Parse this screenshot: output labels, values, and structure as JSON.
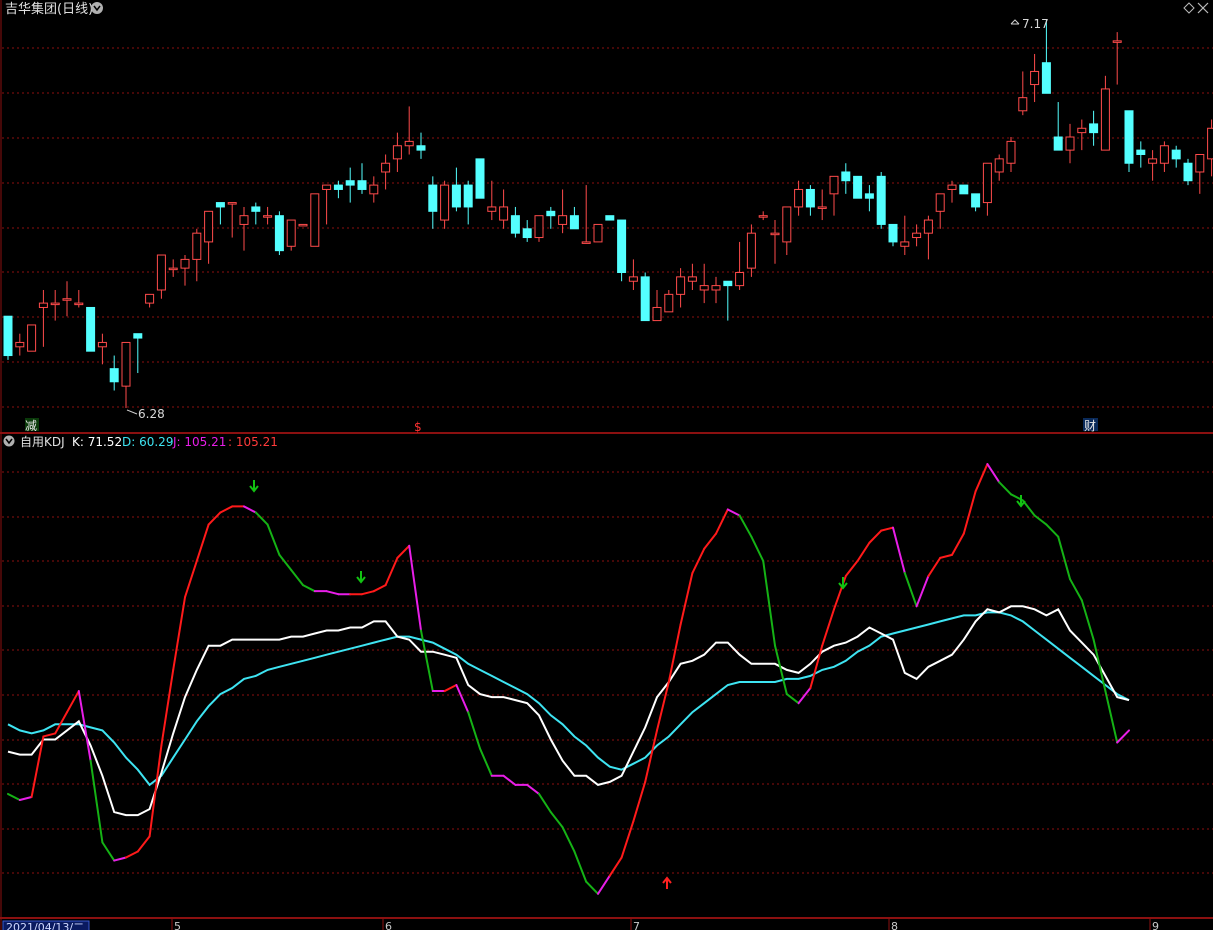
{
  "header": {
    "title": "吉华集团(日线)",
    "high_label": "7.17",
    "low_label": "6.28"
  },
  "markers": {
    "jian": "减",
    "s": "$",
    "cai": "财"
  },
  "indicator": {
    "name": "自用KDJ",
    "k_label": "K: 71.52",
    "d_label": "D: 60.29",
    "j_label": "J: 105.21",
    "extra_label": ": 105.21"
  },
  "date_axis": {
    "current_date": "2021/04/13/二",
    "month_ticks": [
      "5",
      "6",
      "7",
      "8",
      "9"
    ]
  },
  "colors": {
    "background": "#000000",
    "up": "#ff4b4b",
    "down": "#54ffff",
    "grid": "#8b1010",
    "k_line": "#ffffff",
    "d_line": "#3ee4f2",
    "j_up": "#ff1a1a",
    "j_down": "#15b215",
    "j_turn": "#e81ee8",
    "arrow_down": "#12c212",
    "arrow_up": "#ff2020"
  },
  "chart_data": [
    {
      "type": "candlestick",
      "title": "吉华集团(日线)",
      "price_annotations": [
        {
          "label": "7.17",
          "price": 7.17
        },
        {
          "label": "6.28",
          "price": 6.28
        }
      ],
      "candles": [
        {
          "o": 6.49,
          "h": 6.49,
          "l": 6.39,
          "c": 6.4
        },
        {
          "o": 6.42,
          "h": 6.45,
          "l": 6.4,
          "c": 6.43
        },
        {
          "o": 6.41,
          "h": 6.47,
          "l": 6.41,
          "c": 6.47
        },
        {
          "o": 6.51,
          "h": 6.55,
          "l": 6.42,
          "c": 6.52
        },
        {
          "o": 6.52,
          "h": 6.55,
          "l": 6.48,
          "c": 6.52
        },
        {
          "o": 6.53,
          "h": 6.57,
          "l": 6.49,
          "c": 6.53
        },
        {
          "o": 6.52,
          "h": 6.55,
          "l": 6.51,
          "c": 6.52
        },
        {
          "o": 6.51,
          "h": 6.51,
          "l": 6.41,
          "c": 6.41
        },
        {
          "o": 6.42,
          "h": 6.45,
          "l": 6.38,
          "c": 6.43
        },
        {
          "o": 6.37,
          "h": 6.4,
          "l": 6.32,
          "c": 6.34
        },
        {
          "o": 6.33,
          "h": 6.42,
          "l": 6.28,
          "c": 6.43
        },
        {
          "o": 6.45,
          "h": 6.45,
          "l": 6.36,
          "c": 6.44
        },
        {
          "o": 6.52,
          "h": 6.53,
          "l": 6.51,
          "c": 6.54
        },
        {
          "o": 6.55,
          "h": 6.56,
          "l": 6.53,
          "c": 6.63
        },
        {
          "o": 6.6,
          "h": 6.62,
          "l": 6.58,
          "c": 6.6
        },
        {
          "o": 6.6,
          "h": 6.63,
          "l": 6.56,
          "c": 6.62
        },
        {
          "o": 6.62,
          "h": 6.69,
          "l": 6.57,
          "c": 6.68
        },
        {
          "o": 6.66,
          "h": 6.68,
          "l": 6.61,
          "c": 6.73
        },
        {
          "o": 6.75,
          "h": 6.75,
          "l": 6.7,
          "c": 6.74
        },
        {
          "o": 6.75,
          "h": 6.75,
          "l": 6.67,
          "c": 6.75
        },
        {
          "o": 6.7,
          "h": 6.74,
          "l": 6.64,
          "c": 6.72
        },
        {
          "o": 6.74,
          "h": 6.75,
          "l": 6.7,
          "c": 6.73
        },
        {
          "o": 6.72,
          "h": 6.74,
          "l": 6.7,
          "c": 6.72
        },
        {
          "o": 6.72,
          "h": 6.73,
          "l": 6.63,
          "c": 6.64
        },
        {
          "o": 6.65,
          "h": 6.69,
          "l": 6.64,
          "c": 6.71
        },
        {
          "o": 6.7,
          "h": 6.7,
          "l": 6.7,
          "c": 6.7
        },
        {
          "o": 6.65,
          "h": 6.72,
          "l": 6.66,
          "c": 6.77
        },
        {
          "o": 6.78,
          "h": 6.79,
          "l": 6.7,
          "c": 6.79
        },
        {
          "o": 6.79,
          "h": 6.8,
          "l": 6.76,
          "c": 6.78
        },
        {
          "o": 6.8,
          "h": 6.83,
          "l": 6.75,
          "c": 6.79
        },
        {
          "o": 6.8,
          "h": 6.84,
          "l": 6.77,
          "c": 6.78
        },
        {
          "o": 6.77,
          "h": 6.81,
          "l": 6.75,
          "c": 6.79
        },
        {
          "o": 6.82,
          "h": 6.86,
          "l": 6.78,
          "c": 6.84
        },
        {
          "o": 6.85,
          "h": 6.91,
          "l": 6.82,
          "c": 6.88
        },
        {
          "o": 6.88,
          "h": 6.97,
          "l": 6.86,
          "c": 6.89
        },
        {
          "o": 6.88,
          "h": 6.91,
          "l": 6.85,
          "c": 6.87
        },
        {
          "o": 6.79,
          "h": 6.81,
          "l": 6.69,
          "c": 6.73
        },
        {
          "o": 6.71,
          "h": 6.8,
          "l": 6.69,
          "c": 6.79
        },
        {
          "o": 6.79,
          "h": 6.83,
          "l": 6.73,
          "c": 6.74
        },
        {
          "o": 6.79,
          "h": 6.8,
          "l": 6.7,
          "c": 6.74
        },
        {
          "o": 6.85,
          "h": 6.83,
          "l": 6.78,
          "c": 6.76
        },
        {
          "o": 6.73,
          "h": 6.8,
          "l": 6.71,
          "c": 6.74
        },
        {
          "o": 6.71,
          "h": 6.78,
          "l": 6.69,
          "c": 6.74
        },
        {
          "o": 6.72,
          "h": 6.74,
          "l": 6.67,
          "c": 6.68
        },
        {
          "o": 6.69,
          "h": 6.71,
          "l": 6.66,
          "c": 6.67
        },
        {
          "o": 6.67,
          "h": 6.72,
          "l": 6.66,
          "c": 6.72
        },
        {
          "o": 6.73,
          "h": 6.74,
          "l": 6.69,
          "c": 6.72
        },
        {
          "o": 6.7,
          "h": 6.78,
          "l": 6.68,
          "c": 6.72
        },
        {
          "o": 6.72,
          "h": 6.74,
          "l": 6.69,
          "c": 6.69
        },
        {
          "o": 6.66,
          "h": 6.79,
          "l": 6.7,
          "c": 6.66
        },
        {
          "o": 6.66,
          "h": 6.7,
          "l": 6.66,
          "c": 6.7
        },
        {
          "o": 6.72,
          "h": 6.7,
          "l": 6.71,
          "c": 6.71
        },
        {
          "o": 6.71,
          "h": 6.71,
          "l": 6.57,
          "c": 6.59
        },
        {
          "o": 6.57,
          "h": 6.62,
          "l": 6.55,
          "c": 6.58
        },
        {
          "o": 6.58,
          "h": 6.59,
          "l": 6.48,
          "c": 6.48
        },
        {
          "o": 6.48,
          "h": 6.55,
          "l": 6.48,
          "c": 6.51
        },
        {
          "o": 6.5,
          "h": 6.55,
          "l": 6.5,
          "c": 6.54
        },
        {
          "o": 6.54,
          "h": 6.6,
          "l": 6.51,
          "c": 6.58
        },
        {
          "o": 6.57,
          "h": 6.61,
          "l": 6.55,
          "c": 6.58
        },
        {
          "o": 6.55,
          "h": 6.61,
          "l": 6.52,
          "c": 6.56
        },
        {
          "o": 6.55,
          "h": 6.58,
          "l": 6.52,
          "c": 6.56
        },
        {
          "o": 6.57,
          "h": 6.56,
          "l": 6.48,
          "c": 6.56
        },
        {
          "o": 6.56,
          "h": 6.66,
          "l": 6.55,
          "c": 6.59
        },
        {
          "o": 6.6,
          "h": 6.7,
          "l": 6.58,
          "c": 6.68
        },
        {
          "o": 6.72,
          "h": 6.73,
          "l": 6.71,
          "c": 6.72
        },
        {
          "o": 6.68,
          "h": 6.71,
          "l": 6.61,
          "c": 6.68
        },
        {
          "o": 6.66,
          "h": 6.74,
          "l": 6.63,
          "c": 6.74
        },
        {
          "o": 6.74,
          "h": 6.8,
          "l": 6.72,
          "c": 6.78
        },
        {
          "o": 6.78,
          "h": 6.79,
          "l": 6.72,
          "c": 6.74
        },
        {
          "o": 6.74,
          "h": 6.78,
          "l": 6.71,
          "c": 6.74
        },
        {
          "o": 6.77,
          "h": 6.79,
          "l": 6.72,
          "c": 6.81
        },
        {
          "o": 6.82,
          "h": 6.84,
          "l": 6.77,
          "c": 6.8
        },
        {
          "o": 6.81,
          "h": 6.81,
          "l": 6.76,
          "c": 6.76
        },
        {
          "o": 6.77,
          "h": 6.79,
          "l": 6.73,
          "c": 6.76
        },
        {
          "o": 6.81,
          "h": 6.82,
          "l": 6.69,
          "c": 6.7
        },
        {
          "o": 6.7,
          "h": 6.7,
          "l": 6.65,
          "c": 6.66
        },
        {
          "o": 6.65,
          "h": 6.72,
          "l": 6.63,
          "c": 6.66
        },
        {
          "o": 6.67,
          "h": 6.7,
          "l": 6.65,
          "c": 6.68
        },
        {
          "o": 6.68,
          "h": 6.72,
          "l": 6.62,
          "c": 6.71
        },
        {
          "o": 6.73,
          "h": 6.77,
          "l": 6.69,
          "c": 6.77
        },
        {
          "o": 6.78,
          "h": 6.8,
          "l": 6.75,
          "c": 6.79
        },
        {
          "o": 6.79,
          "h": 6.79,
          "l": 6.77,
          "c": 6.77
        },
        {
          "o": 6.77,
          "h": 6.77,
          "l": 6.73,
          "c": 6.74
        },
        {
          "o": 6.75,
          "h": 6.82,
          "l": 6.72,
          "c": 6.84
        },
        {
          "o": 6.82,
          "h": 6.86,
          "l": 6.8,
          "c": 6.85
        },
        {
          "o": 6.84,
          "h": 6.9,
          "l": 6.82,
          "c": 6.89
        },
        {
          "o": 6.96,
          "h": 7.05,
          "l": 6.95,
          "c": 6.99
        },
        {
          "o": 7.02,
          "h": 7.09,
          "l": 6.98,
          "c": 7.05
        },
        {
          "o": 7.07,
          "h": 7.17,
          "l": 7.04,
          "c": 7.0
        },
        {
          "o": 6.9,
          "h": 6.98,
          "l": 6.87,
          "c": 6.87
        },
        {
          "o": 6.87,
          "h": 6.93,
          "l": 6.84,
          "c": 6.9
        },
        {
          "o": 6.91,
          "h": 6.94,
          "l": 6.87,
          "c": 6.92
        },
        {
          "o": 6.93,
          "h": 6.96,
          "l": 6.88,
          "c": 6.91
        },
        {
          "o": 6.87,
          "h": 7.04,
          "l": 6.87,
          "c": 7.01
        },
        {
          "o": 7.12,
          "h": 7.14,
          "l": 7.02,
          "c": 7.12
        },
        {
          "o": 6.96,
          "h": 6.96,
          "l": 6.82,
          "c": 6.84
        },
        {
          "o": 6.87,
          "h": 6.89,
          "l": 6.83,
          "c": 6.86
        },
        {
          "o": 6.84,
          "h": 6.87,
          "l": 6.8,
          "c": 6.85
        },
        {
          "o": 6.84,
          "h": 6.89,
          "l": 6.82,
          "c": 6.88
        },
        {
          "o": 6.87,
          "h": 6.88,
          "l": 6.83,
          "c": 6.85
        },
        {
          "o": 6.84,
          "h": 6.85,
          "l": 6.79,
          "c": 6.8
        },
        {
          "o": 6.82,
          "h": 6.84,
          "l": 6.77,
          "c": 6.86
        },
        {
          "o": 6.85,
          "h": 6.94,
          "l": 6.81,
          "c": 6.92
        }
      ]
    },
    {
      "type": "line",
      "title": "自用KDJ",
      "series": [
        {
          "name": "K",
          "values": [
            53,
            52,
            52,
            57,
            57,
            60,
            63,
            55,
            45,
            33,
            32,
            32,
            34,
            46,
            59,
            71,
            80,
            88,
            88,
            90,
            90,
            90,
            90,
            90,
            91,
            91,
            92,
            93,
            93,
            94,
            94,
            96,
            96,
            91,
            90,
            86,
            86,
            85,
            84,
            75,
            72,
            71,
            71,
            70,
            69,
            65,
            57,
            50,
            45,
            45,
            42,
            43,
            45,
            53,
            61,
            71,
            76,
            82,
            83,
            85,
            89,
            89,
            85,
            82,
            82,
            82,
            80,
            79,
            82,
            86,
            88,
            89,
            91,
            94,
            92,
            90,
            79,
            77,
            81,
            83,
            85,
            90,
            96,
            100,
            99,
            101,
            101,
            100,
            98,
            100,
            93,
            89,
            85,
            78,
            71,
            70
          ]
        },
        {
          "name": "D",
          "values": [
            62,
            60,
            59,
            60,
            62,
            62,
            62,
            61,
            60,
            56,
            51,
            47,
            42,
            45,
            51,
            57,
            63,
            68,
            72,
            74,
            77,
            78,
            80,
            81,
            82,
            83,
            84,
            85,
            86,
            87,
            88,
            89,
            90,
            91,
            91,
            90,
            89,
            87,
            85,
            82,
            80,
            78,
            76,
            74,
            72,
            69,
            65,
            62,
            58,
            55,
            51,
            48,
            47,
            49,
            51,
            55,
            58,
            62,
            66,
            69,
            72,
            75,
            76,
            76,
            76,
            76,
            77,
            77,
            78,
            80,
            81,
            83,
            86,
            88,
            91,
            92,
            93,
            94,
            95,
            96,
            97,
            98,
            98,
            99,
            99,
            98,
            96,
            93,
            90,
            87,
            84,
            81,
            78,
            75,
            72,
            70
          ]
        },
        {
          "name": "J",
          "values": [
            39,
            37,
            38,
            58,
            59,
            66,
            73,
            50,
            23,
            17,
            18,
            20,
            25,
            55,
            80,
            104,
            116,
            128,
            132,
            134,
            134,
            132,
            128,
            118,
            113,
            108,
            106,
            106,
            105,
            105,
            105,
            106,
            108,
            117,
            121,
            93,
            73,
            73,
            75,
            66,
            54,
            45,
            45,
            42,
            42,
            39,
            33,
            28,
            20,
            10,
            6,
            12,
            18,
            30,
            43,
            60,
            76,
            95,
            112,
            120,
            125,
            133,
            131,
            124,
            116,
            88,
            72,
            69,
            74,
            88,
            100,
            111,
            116,
            122,
            126,
            127,
            112,
            101,
            111,
            117,
            118,
            125,
            139,
            148,
            142,
            138,
            136,
            131,
            128,
            124,
            110,
            103,
            90,
            73,
            56,
            60
          ]
        }
      ],
      "ylim": [
        0,
        150
      ]
    }
  ]
}
